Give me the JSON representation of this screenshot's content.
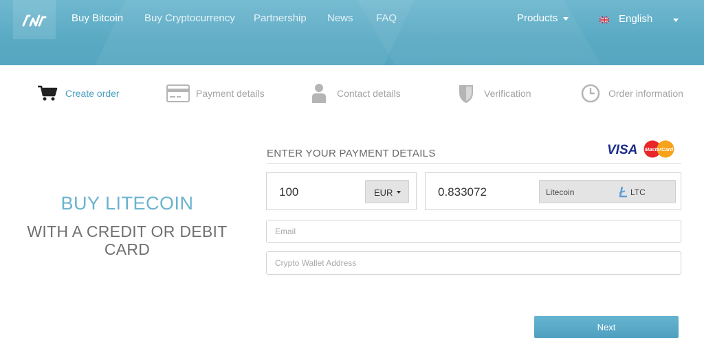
{
  "nav": {
    "links": [
      "Buy Bitcoin",
      "Buy Cryptocurrency",
      "Partnership",
      "News",
      "FAQ"
    ],
    "products": "Products",
    "language": "English"
  },
  "steps": [
    "Create order",
    "Payment details",
    "Contact details",
    "Verification",
    "Order information"
  ],
  "hero": {
    "title": "BUY LITECOIN",
    "subtitle_line1": "WITH A CREDIT OR DEBIT",
    "subtitle_line2": "CARD"
  },
  "form": {
    "section_title": "ENTER YOUR PAYMENT DETAILS",
    "amount": "100",
    "currency": "EUR",
    "crypto_amount": "0.833072",
    "crypto_name": "Litecoin",
    "crypto_code": "LTC",
    "email_placeholder": "Email",
    "wallet_placeholder": "Crypto Wallet Address",
    "next_label": "Next"
  },
  "payment_logos": {
    "visa": "VISA",
    "mastercard": "MasterCard"
  },
  "colors": {
    "header": "#5aaac4",
    "accent": "#4a9fc0",
    "hero_title": "#6ab3cf",
    "button": "#55a4c3"
  }
}
